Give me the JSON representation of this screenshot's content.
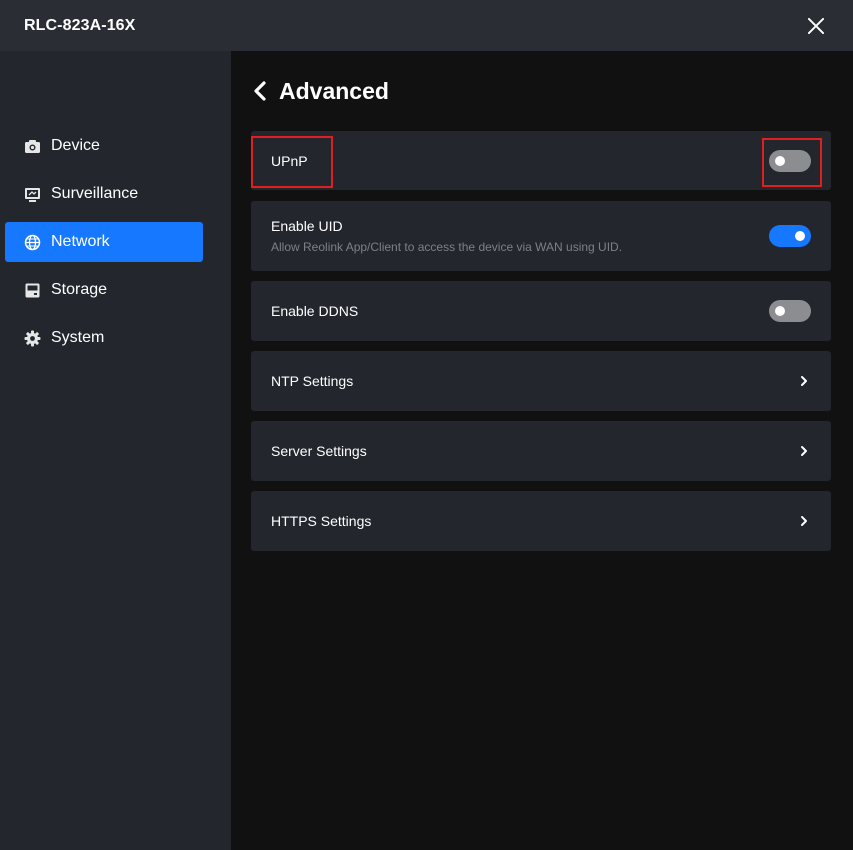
{
  "window": {
    "title": "RLC-823A-16X"
  },
  "sidebar": {
    "items": [
      {
        "label": "Device",
        "icon": "camera-icon",
        "active": false
      },
      {
        "label": "Surveillance",
        "icon": "monitor-icon",
        "active": false
      },
      {
        "label": "Network",
        "icon": "globe-icon",
        "active": true
      },
      {
        "label": "Storage",
        "icon": "storage-icon",
        "active": false
      },
      {
        "label": "System",
        "icon": "gear-icon",
        "active": false
      }
    ]
  },
  "page": {
    "title": "Advanced"
  },
  "settings": {
    "upnp": {
      "label": "UPnP",
      "enabled": false
    },
    "uid": {
      "label": "Enable UID",
      "description": "Allow Reolink App/Client to access the device via WAN using UID.",
      "enabled": true
    },
    "ddns": {
      "label": "Enable DDNS",
      "enabled": false
    },
    "ntp": {
      "label": "NTP Settings"
    },
    "server": {
      "label": "Server Settings"
    },
    "https": {
      "label": "HTTPS Settings"
    }
  },
  "colors": {
    "accent": "#1677ff",
    "highlight": "#e02020",
    "toggle_off": "#8b8d91",
    "sidebar_bg": "#23262d",
    "main_bg": "#111112"
  }
}
